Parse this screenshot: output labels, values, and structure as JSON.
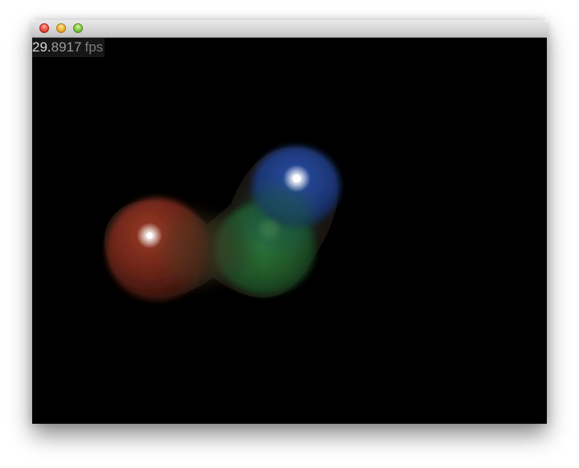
{
  "window": {
    "title": ""
  },
  "overlay": {
    "fps_integer": "29.",
    "fps_fraction": "8917",
    "fps_unit": "fps"
  },
  "scene": {
    "background": "#000000",
    "blobs": [
      {
        "name": "red-blob",
        "color": "#7a2a1c"
      },
      {
        "name": "green-blob",
        "color": "#2a6a30"
      },
      {
        "name": "blue-blob",
        "color": "#22408a"
      }
    ]
  },
  "colors": {
    "titlebar": "#d6d6d6",
    "close": "#f4584e",
    "minimize": "#f7bb3a",
    "zoom": "#8fd14a"
  }
}
